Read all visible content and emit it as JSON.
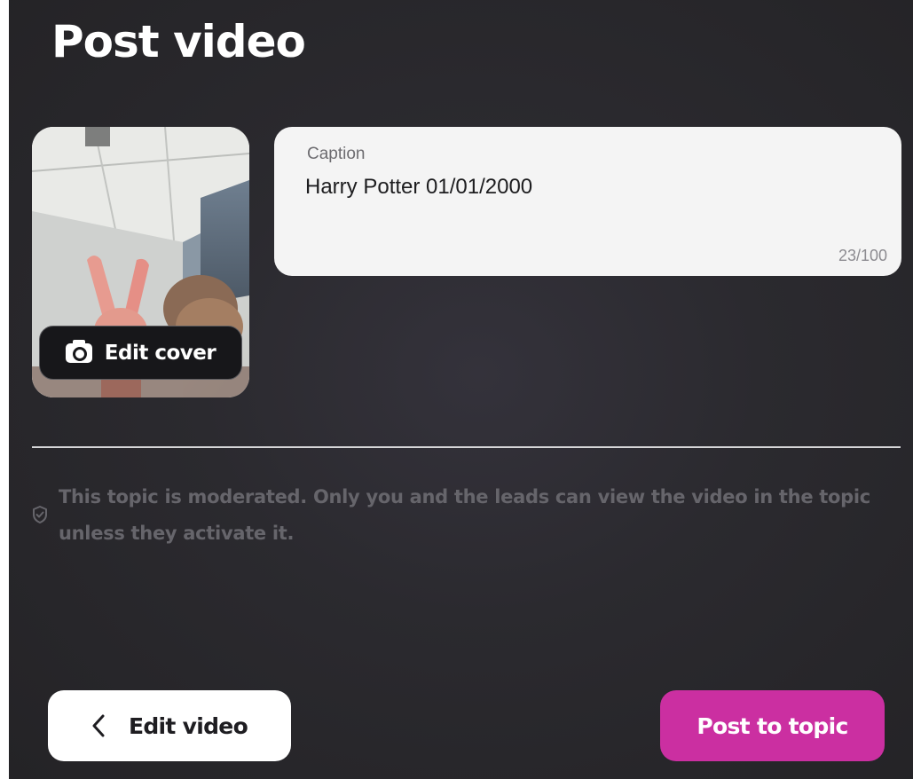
{
  "header": {
    "title": "Post video"
  },
  "cover": {
    "edit_label": "Edit cover",
    "icon": "camera-icon"
  },
  "caption": {
    "label": "Caption",
    "value": "Harry Potter 01/01/2000",
    "count": "23/100"
  },
  "notice": {
    "icon": "shield-check-icon",
    "text": "This topic is moderated. Only you and the leads can view the video in the topic unless they activate it."
  },
  "footer": {
    "back_icon": "chevron-left-icon",
    "edit_video_label": "Edit video",
    "post_label": "Post to topic"
  },
  "colors": {
    "background": "#2b2a2f",
    "accent": "#cb2fa1",
    "caption_bg": "#f4f4f4",
    "muted_text": "#66656b"
  }
}
